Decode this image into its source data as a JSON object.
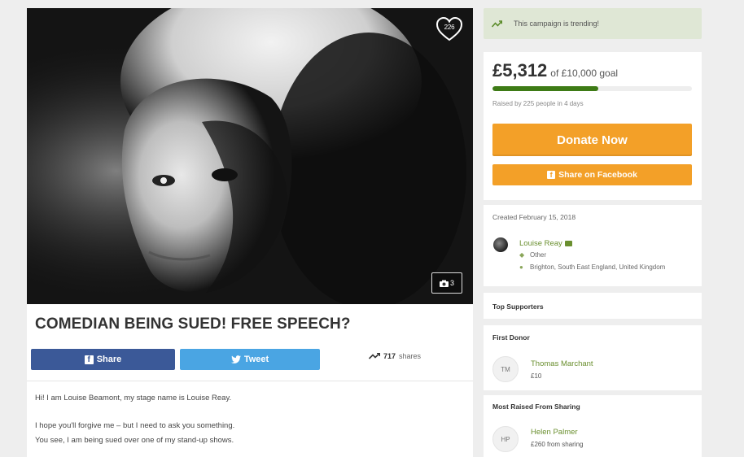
{
  "hero": {
    "favourites_count": "226",
    "photo_count": "3"
  },
  "campaign": {
    "title": "COMEDIAN BEING SUED! FREE SPEECH?",
    "share_facebook_label": "Share",
    "share_twitter_label": "Tweet",
    "shares_count": "717",
    "shares_label": "shares",
    "story": [
      "Hi! I am Louise Beamont, my stage name is Louise Reay.",
      "I hope you'll forgive me – but I need to ask you something.",
      "You see, I am being sued over one of my stand-up shows."
    ]
  },
  "sidebar": {
    "trending_text": "This campaign is trending!",
    "amount_raised": "£5,312",
    "goal_text": "of £10,000 goal",
    "progress_fraction": 0.5312,
    "raised_by": "Raised by 225 people in 4 days",
    "donate_label": "Donate Now",
    "share_facebook_label": "Share on Facebook",
    "created": "Created February 15, 2018",
    "organiser": {
      "name": "Louise Reay",
      "category": "Other",
      "location": "Brighton, South East England, United Kingdom"
    },
    "top_supporters_heading": "Top Supporters",
    "first_donor_heading": "First Donor",
    "first_donor": {
      "initials": "TM",
      "name": "Thomas Marchant",
      "amount": "£10"
    },
    "most_shared_heading": "Most Raised From Sharing",
    "most_shared": {
      "initials": "HP",
      "name": "Helen Palmer",
      "amount": "£260 from sharing"
    }
  },
  "colors": {
    "facebook": "#3b5998",
    "twitter": "#4aa5e3",
    "donate": "#f3a028",
    "progress": "#3e7b16",
    "link_green": "#6a8f2f",
    "trending_bg": "#dfe7d5"
  },
  "icons": [
    "heart-icon",
    "camera-icon",
    "facebook-icon",
    "twitter-icon",
    "trending-icon",
    "mail-icon",
    "tag-icon",
    "location-pin-icon"
  ]
}
